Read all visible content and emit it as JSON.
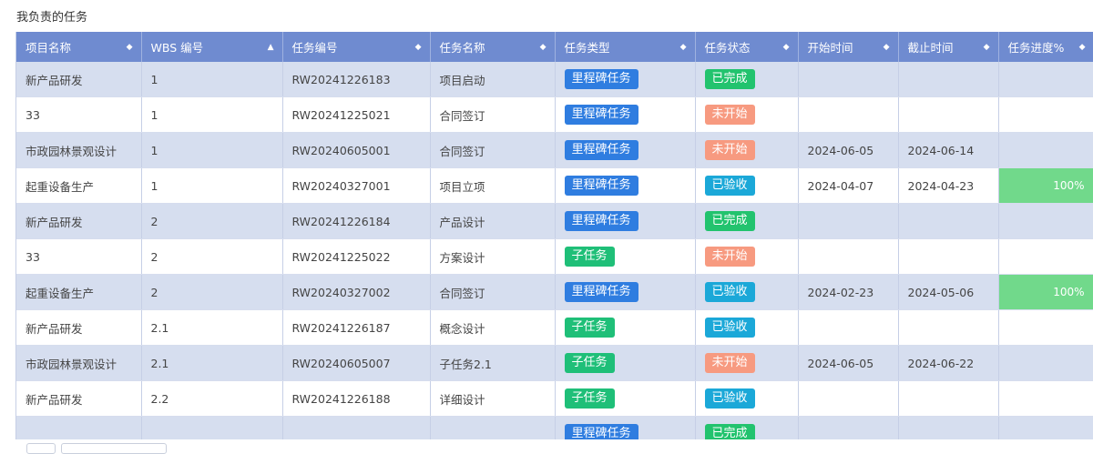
{
  "page": {
    "title": "我负责的任务"
  },
  "columns": [
    {
      "label": "项目名称",
      "sort_icon": "sort-both-icon"
    },
    {
      "label": "WBS 编号",
      "sort_icon": "sort-asc-icon"
    },
    {
      "label": "任务编号",
      "sort_icon": "sort-both-icon"
    },
    {
      "label": "任务名称",
      "sort_icon": "sort-both-icon"
    },
    {
      "label": "任务类型",
      "sort_icon": "sort-both-icon"
    },
    {
      "label": "任务状态",
      "sort_icon": "sort-both-icon"
    },
    {
      "label": "开始时间",
      "sort_icon": "sort-both-icon"
    },
    {
      "label": "截止时间",
      "sort_icon": "sort-both-icon"
    },
    {
      "label": "任务进度%",
      "sort_icon": "sort-both-icon"
    }
  ],
  "rows": [
    {
      "project": "新产品研发",
      "wbs": "1",
      "task_no": "RW20241226183",
      "task_name": "项目启动",
      "type": "里程碑任务",
      "status": "已完成",
      "start": "",
      "end": "",
      "progress": ""
    },
    {
      "project": "33",
      "wbs": "1",
      "task_no": "RW20241225021",
      "task_name": "合同签订",
      "type": "里程碑任务",
      "status": "未开始",
      "start": "",
      "end": "",
      "progress": ""
    },
    {
      "project": "市政园林景观设计",
      "wbs": "1",
      "task_no": "RW20240605001",
      "task_name": "合同签订",
      "type": "里程碑任务",
      "status": "未开始",
      "start": "2024-06-05",
      "end": "2024-06-14",
      "progress": ""
    },
    {
      "project": "起重设备生产",
      "wbs": "1",
      "task_no": "RW20240327001",
      "task_name": "项目立项",
      "type": "里程碑任务",
      "status": "已验收",
      "start": "2024-04-07",
      "end": "2024-04-23",
      "progress": "100%"
    },
    {
      "project": "新产品研发",
      "wbs": "2",
      "task_no": "RW20241226184",
      "task_name": "产品设计",
      "type": "里程碑任务",
      "status": "已完成",
      "start": "",
      "end": "",
      "progress": ""
    },
    {
      "project": "33",
      "wbs": "2",
      "task_no": "RW20241225022",
      "task_name": "方案设计",
      "type": "子任务",
      "status": "未开始",
      "start": "",
      "end": "",
      "progress": ""
    },
    {
      "project": "起重设备生产",
      "wbs": "2",
      "task_no": "RW20240327002",
      "task_name": "合同签订",
      "type": "里程碑任务",
      "status": "已验收",
      "start": "2024-02-23",
      "end": "2024-05-06",
      "progress": "100%"
    },
    {
      "project": "新产品研发",
      "wbs": "2.1",
      "task_no": "RW20241226187",
      "task_name": "概念设计",
      "type": "子任务",
      "status": "已验收",
      "start": "",
      "end": "",
      "progress": ""
    },
    {
      "project": "市政园林景观设计",
      "wbs": "2.1",
      "task_no": "RW20240605007",
      "task_name": "子任务2.1",
      "type": "子任务",
      "status": "未开始",
      "start": "2024-06-05",
      "end": "2024-06-22",
      "progress": ""
    },
    {
      "project": "新产品研发",
      "wbs": "2.2",
      "task_no": "RW20241226188",
      "task_name": "详细设计",
      "type": "子任务",
      "status": "已验收",
      "start": "",
      "end": "",
      "progress": ""
    },
    {
      "project": "",
      "wbs": "",
      "task_no": "",
      "task_name": "",
      "type": "里程碑任务",
      "status": "已完成",
      "start": "",
      "end": "",
      "progress": ""
    }
  ],
  "colors": {
    "header_bg": "#6f8bd0",
    "row_alt_bg": "#d6deef",
    "milestone": "#2f7de0",
    "subtask": "#1fbf78",
    "status_done": "#22c36e",
    "status_not_started": "#f79a80",
    "status_accepted": "#1ba8d8",
    "progress_fill": "#71d98b"
  }
}
